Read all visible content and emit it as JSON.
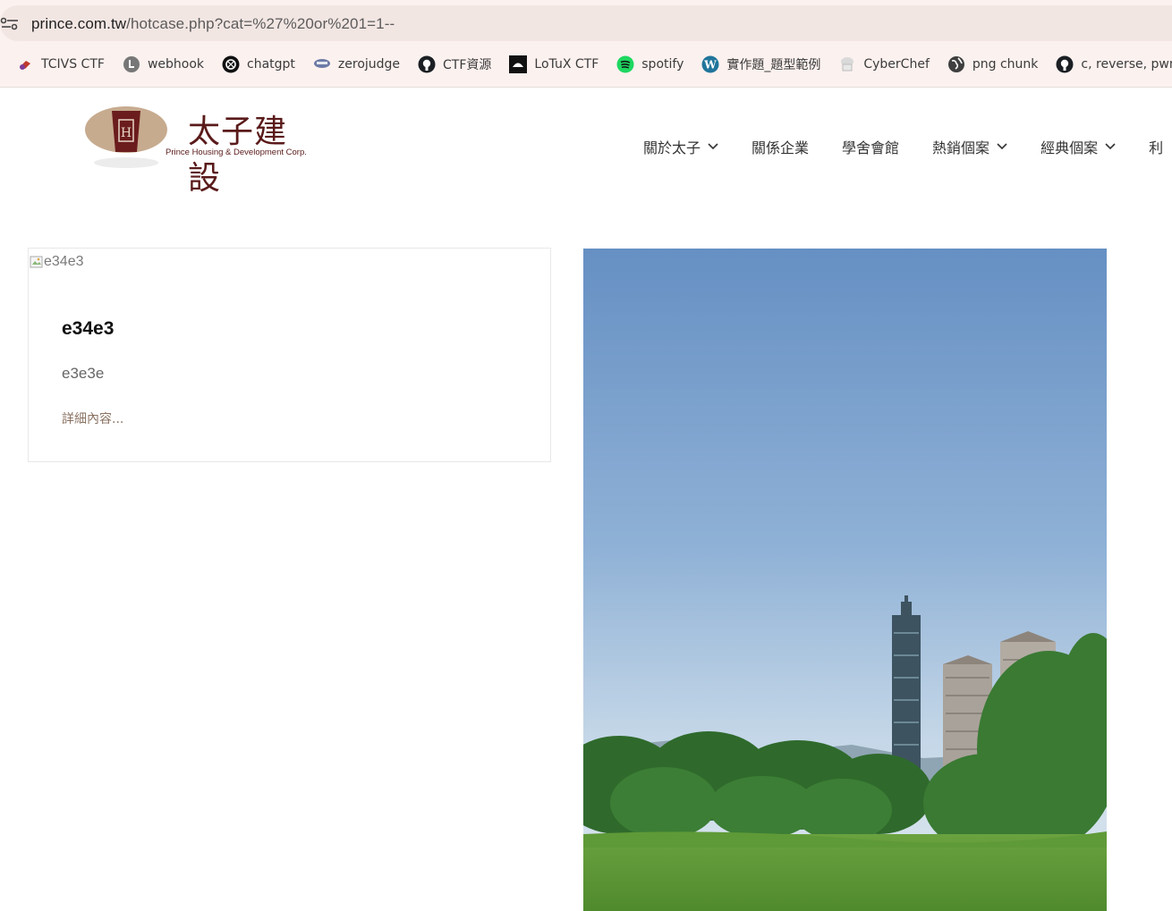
{
  "browser": {
    "url_host": "prince.com.tw",
    "url_path": "/hotcase.php?cat=%27%20or%201=1--",
    "bookmarks": [
      {
        "label": "TCIVS CTF",
        "icon": "tcivs-icon"
      },
      {
        "label": "webhook",
        "icon": "webhook-icon"
      },
      {
        "label": "chatgpt",
        "icon": "chatgpt-icon"
      },
      {
        "label": "zerojudge",
        "icon": "zerojudge-icon"
      },
      {
        "label": "CTF資源",
        "icon": "github-icon"
      },
      {
        "label": "LoTuX CTF",
        "icon": "lotux-icon"
      },
      {
        "label": "spotify",
        "icon": "spotify-icon"
      },
      {
        "label": "實作題_題型範例",
        "icon": "wordpress-icon"
      },
      {
        "label": "CyberChef",
        "icon": "cyberchef-icon"
      },
      {
        "label": "png chunk",
        "icon": "globe-icon"
      },
      {
        "label": "c, reverse, pwn",
        "icon": "github-icon"
      }
    ]
  },
  "site": {
    "logo_title": "太子建設",
    "logo_subtitle": "Prince Housing & Development Corp.",
    "logo_emblem_text": "H",
    "nav": [
      {
        "label": "關於太子",
        "dropdown": true
      },
      {
        "label": "關係企業",
        "dropdown": false
      },
      {
        "label": "學舍會館",
        "dropdown": false
      },
      {
        "label": "熱銷個案",
        "dropdown": true
      },
      {
        "label": "經典個案",
        "dropdown": true
      },
      {
        "label": "利",
        "dropdown": false
      }
    ]
  },
  "card": {
    "image_alt": "e34e3",
    "title": "e34e3",
    "description": "e3e3e",
    "more_link": "詳細內容..."
  },
  "colors": {
    "brand_maroon": "#6b1d1d",
    "link_brown": "#8a7262",
    "sky_top": "#5f8fc4"
  }
}
